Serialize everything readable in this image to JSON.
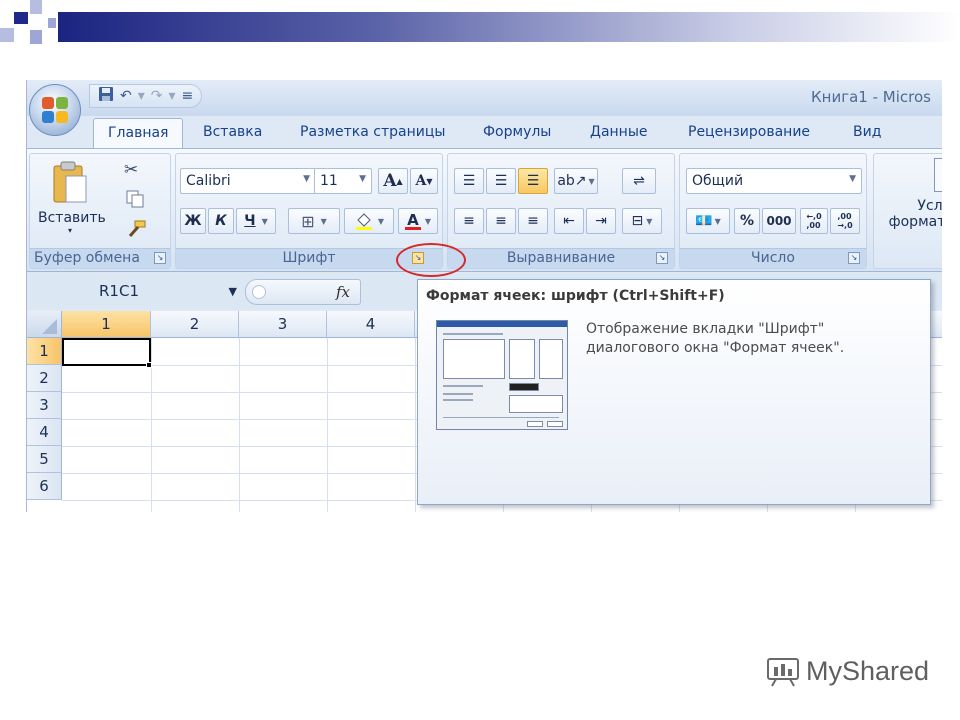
{
  "window": {
    "title": "Книга1 - Micros",
    "quick_access": [
      "save-icon",
      "undo-icon",
      "redo-icon",
      "customize-icon"
    ]
  },
  "tabs": [
    "Главная",
    "Вставка",
    "Разметка страницы",
    "Формулы",
    "Данные",
    "Рецензирование",
    "Вид"
  ],
  "active_tab": "Главная",
  "ribbon": {
    "clipboard": {
      "paste_label": "Вставить",
      "group_label": "Буфер обмена"
    },
    "font": {
      "font_name": "Calibri",
      "font_size": "11",
      "grow_label": "A",
      "shrink_label": "A",
      "bold": "Ж",
      "italic": "К",
      "underline": "Ч",
      "font_color_label": "A",
      "group_label": "Шрифт"
    },
    "alignment": {
      "group_label": "Выравнивание"
    },
    "number": {
      "format": "Общий",
      "percent": "%",
      "thousands": "000",
      "inc_decimal": "←,0\n,00",
      "dec_decimal": ",00\n→,0",
      "group_label": "Число"
    },
    "styles": {
      "label_1": "Усл",
      "label_2": "формат"
    }
  },
  "formula_bar": {
    "name_box": "R1C1",
    "fx_label": "fx"
  },
  "sheet": {
    "columns": [
      "1",
      "2",
      "3",
      "4"
    ],
    "rows": [
      "1",
      "2",
      "3",
      "4",
      "5",
      "6"
    ],
    "selected_column": "1",
    "selected_row": "1"
  },
  "tooltip": {
    "title": "Формат ячеек: шрифт (Ctrl+Shift+F)",
    "description": "Отображение вкладки \"Шрифт\"\nдиалогового окна \"Формат ячеек\"."
  },
  "watermark": {
    "text": "MyShared"
  },
  "colors": {
    "ribbon_text": "#15428b",
    "highlight": "#f8c860",
    "annotation_circle": "#d42a2a",
    "slide_accent": "#1e2a8a"
  }
}
